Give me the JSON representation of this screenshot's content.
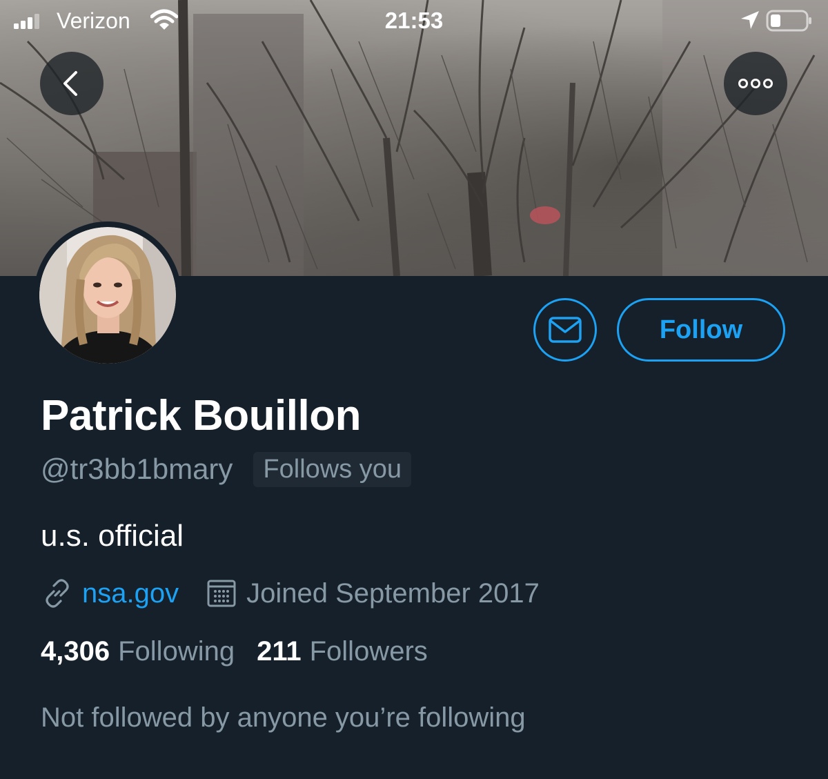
{
  "status_bar": {
    "carrier": "Verizon",
    "time": "21:53"
  },
  "profile": {
    "display_name": "Patrick Bouillon",
    "handle": "@tr3bb1bmary",
    "follows_you_label": "Follows you",
    "bio": "u.s. official",
    "website": "nsa.gov",
    "joined": "Joined September 2017",
    "following_count": "4,306",
    "following_label": "Following",
    "followers_count": "211",
    "followers_label": "Followers",
    "mutuals_text": "Not followed by anyone you’re following"
  },
  "actions": {
    "follow_label": "Follow"
  },
  "icons": {
    "back": "chevron-left-icon",
    "more": "more-horizontal-icon",
    "message": "envelope-icon",
    "link": "link-icon",
    "calendar": "calendar-icon"
  },
  "colors": {
    "background": "#15202b",
    "accent": "#1da1f2",
    "secondary_text": "#8899a6"
  }
}
